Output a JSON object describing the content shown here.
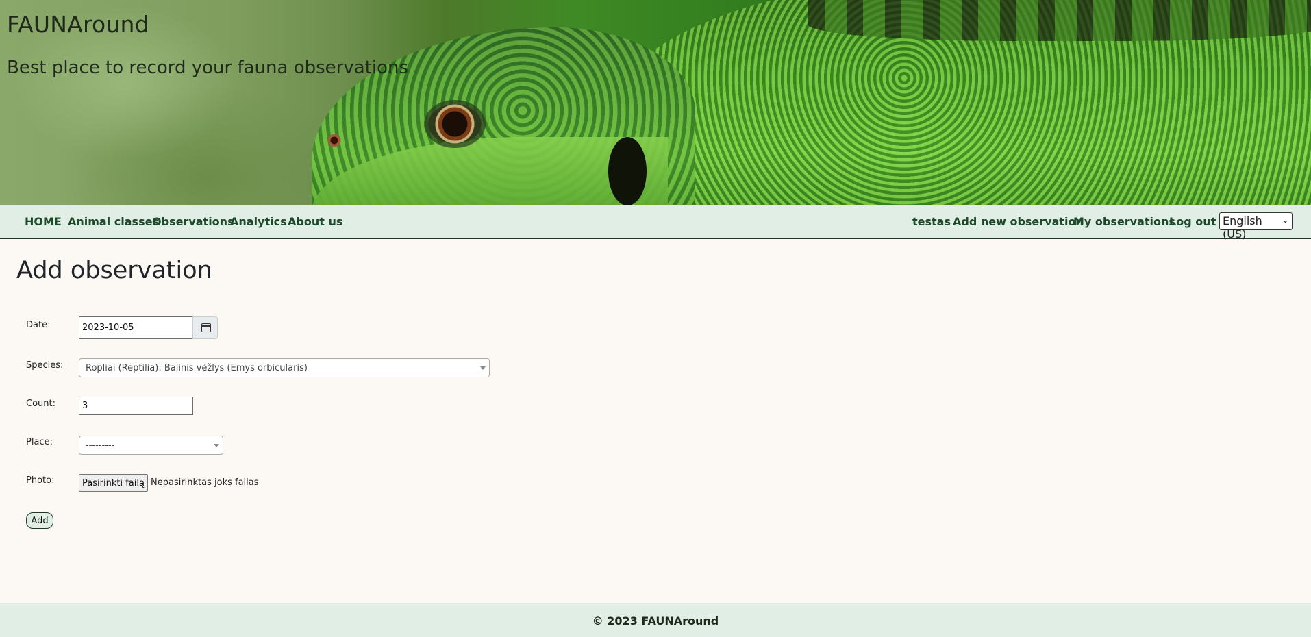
{
  "header": {
    "title": "FAUNAround",
    "subtitle": "Best place to record your fauna observations"
  },
  "nav": {
    "left": [
      "HOME",
      "Animal classes",
      "Observations",
      "Analytics",
      "About us"
    ],
    "right": [
      "testas",
      "Add new observation",
      "My observations",
      "Log out"
    ],
    "language": "English (US)"
  },
  "main": {
    "heading": "Add observation",
    "form": {
      "date_label": "Date:",
      "date_value": "2023-10-05",
      "species_label": "Species:",
      "species_value": "Ropliai (Reptilia): Balinis vėžlys (Emys orbicularis)",
      "count_label": "Count:",
      "count_value": "3",
      "place_label": "Place:",
      "place_value": "---------",
      "photo_label": "Photo:",
      "photo_button": "Pasirinkti failą",
      "photo_status": "Nepasirinktas joks failas",
      "submit_label": "Add"
    }
  },
  "footer": {
    "text": "© 2023 FAUNAround"
  },
  "colors": {
    "nav_bg": "#e1eee6",
    "nav_text": "#1d4a2b",
    "page_bg": "#fcf9f5",
    "border": "#1e3a2a"
  },
  "icons": {
    "calendar": "calendar-icon",
    "dropdown": "chevron-down-icon"
  }
}
